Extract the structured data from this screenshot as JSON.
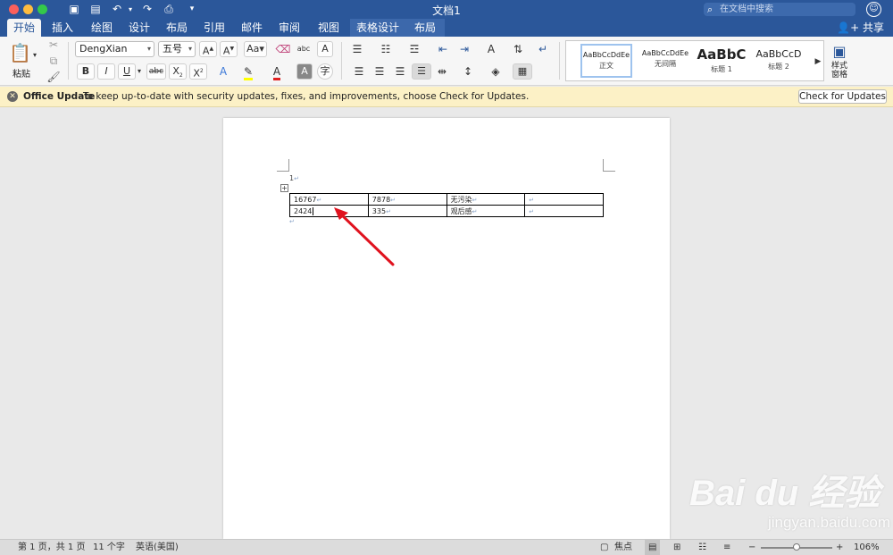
{
  "window": {
    "title": "文档1",
    "search_placeholder": "在文档中搜索",
    "share_label": "共享"
  },
  "tabs": [
    {
      "label": "开始",
      "active": true
    },
    {
      "label": "插入"
    },
    {
      "label": "绘图"
    },
    {
      "label": "设计"
    },
    {
      "label": "布局"
    },
    {
      "label": "引用"
    },
    {
      "label": "邮件"
    },
    {
      "label": "审阅"
    },
    {
      "label": "视图"
    },
    {
      "label": "表格设计",
      "context": true
    },
    {
      "label": "布局",
      "context": true
    }
  ],
  "ribbon": {
    "paste_label": "粘贴",
    "font_name": "DengXian Reg...",
    "font_size": "五号",
    "styles": [
      {
        "sample": "AaBbCcDdEe",
        "name": "正文"
      },
      {
        "sample": "AaBbCcDdEe",
        "name": "无间隔"
      },
      {
        "sample": "AaBbC",
        "name": "标题 1"
      },
      {
        "sample": "AaBbCcD",
        "name": "标题 2"
      }
    ],
    "styles_pane_label": "样式\n窗格",
    "accent_color": "#2b579a",
    "font_color": "#e02020",
    "highlight_color": "#ffff00"
  },
  "notification": {
    "title": "Office Update",
    "message": "To keep up-to-date with security updates, fixes, and improvements, choose Check for Updates.",
    "button": "Check for Updates"
  },
  "document": {
    "paragraph_number": "1",
    "table": {
      "rows": [
        [
          "16767",
          "7878",
          "无污染",
          ""
        ],
        [
          "2424",
          "335",
          "观后感",
          ""
        ]
      ]
    }
  },
  "status": {
    "page": "第 1 页，共 1 页",
    "words": "11 个字",
    "language": "英语(美国)",
    "focus": "焦点",
    "zoom": "106%",
    "zoom_level": 0.5
  },
  "watermark": {
    "logo_text": "Bai du 经验",
    "sub_text": "jingyan.baidu.com"
  }
}
